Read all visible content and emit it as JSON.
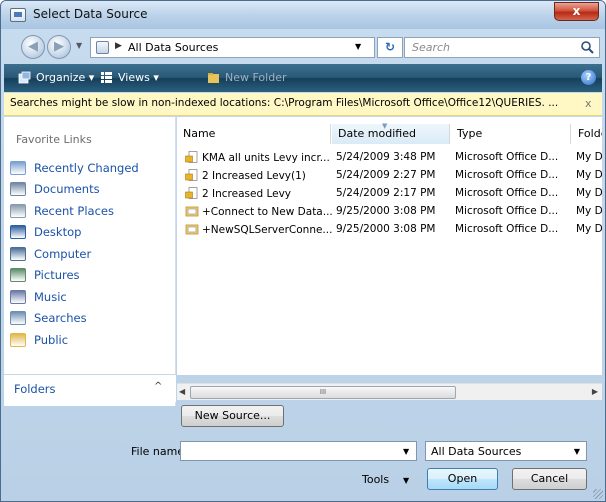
{
  "window": {
    "title": "Select Data Source",
    "close_label": "x"
  },
  "navbar": {
    "back_glyph": "◀",
    "forward_glyph": "▶",
    "address_text": "All Data Sources",
    "search_placeholder": "Search",
    "refresh_glyph": "↻"
  },
  "commandbar": {
    "organize_label": "Organize",
    "views_label": "Views",
    "newfolder_label": "New Folder",
    "help_label": "?"
  },
  "infobar": {
    "message": "Searches might be slow in non-indexed locations: C:\\Program Files\\Microsoft Office\\Office12\\QUERIES. ...",
    "close_label": "x"
  },
  "favorites": {
    "header": "Favorite Links",
    "items": [
      {
        "label": "Recently Changed",
        "icon": "recently-changed-icon",
        "color": "#7b9fd0"
      },
      {
        "label": "Documents",
        "icon": "documents-icon",
        "color": "#6f86a4"
      },
      {
        "label": "Recent Places",
        "icon": "recent-places-icon",
        "color": "#8a9aae"
      },
      {
        "label": "Desktop",
        "icon": "desktop-icon",
        "color": "#2f5f9e"
      },
      {
        "label": "Computer",
        "icon": "computer-icon",
        "color": "#4a6f95"
      },
      {
        "label": "Pictures",
        "icon": "pictures-icon",
        "color": "#5c8c6a"
      },
      {
        "label": "Music",
        "icon": "music-icon",
        "color": "#6b79a8"
      },
      {
        "label": "Searches",
        "icon": "searches-icon",
        "color": "#6d8fb4"
      },
      {
        "label": "Public",
        "icon": "public-folder-icon",
        "color": "#e0b84a"
      }
    ],
    "folders_label": "Folders"
  },
  "columns": {
    "name": "Name",
    "date": "Date modified",
    "type": "Type",
    "folder": "Folde"
  },
  "files": [
    {
      "name": "KMA all units Levy incr...",
      "date": "5/24/2009 3:48 PM",
      "type": "Microsoft Office D...",
      "folder": "My D",
      "icon": "odc-file-icon"
    },
    {
      "name": "2 Increased Levy(1)",
      "date": "5/24/2009 2:27 PM",
      "type": "Microsoft Office D...",
      "folder": "My D",
      "icon": "odc-file-icon"
    },
    {
      "name": "2 Increased Levy",
      "date": "5/24/2009 2:17 PM",
      "type": "Microsoft Office D...",
      "folder": "My D",
      "icon": "odc-file-icon"
    },
    {
      "name": "+Connect to New Data...",
      "date": "9/25/2000 3:08 PM",
      "type": "Microsoft Office D...",
      "folder": "My D",
      "icon": "connection-file-icon"
    },
    {
      "name": "+NewSQLServerConne...",
      "date": "9/25/2000 3:08 PM",
      "type": "Microsoft Office D...",
      "folder": "My D",
      "icon": "connection-file-icon"
    }
  ],
  "scrollbar": {
    "grip_glyph": "III"
  },
  "bottom": {
    "new_source_label": "New Source...",
    "file_name_label": "File name:",
    "file_name_value": "",
    "filter_value": "All Data Sources",
    "tools_label": "Tools",
    "open_label": "Open",
    "cancel_label": "Cancel"
  }
}
